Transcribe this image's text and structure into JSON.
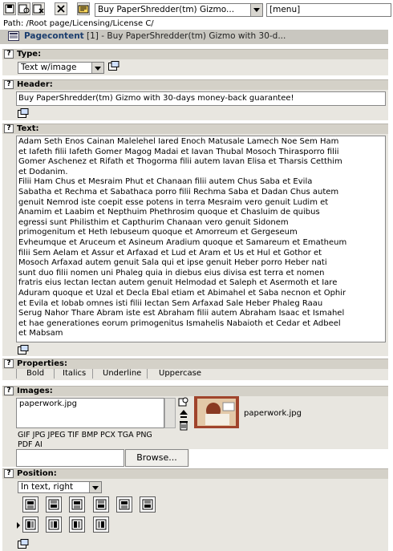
{
  "toolbar": {
    "buttons": [
      "save-icon",
      "save-view-icon",
      "save-close-icon",
      "close-icon",
      "edit-icon"
    ],
    "record_select": "Buy PaperShredder(tm) Gizmo...",
    "menu_select": "[menu]"
  },
  "path": "Path: /Root page/Licensing/License C/",
  "pagecontent": {
    "label": "Pagecontent",
    "title": "[1] - Buy PaperShredder(tm) Gizmo with 30-d..."
  },
  "type": {
    "label": "Type:",
    "value": "Text w/image"
  },
  "header": {
    "label": "Header:",
    "value": "Buy PaperShredder(tm) Gizmo with 30-days money-back guarantee!"
  },
  "text": {
    "label": "Text:",
    "lines": [
      "Adam Seth Enos Cainan Malelehel Iared Enoch Matusale Lamech Noe Sem Ham",
      "et Iafeth filii Iafeth Gomer Magog Madai et Iavan Thubal Mosoch Thirasporro filii",
      "Gomer Aschenez et Rifath et Thogorma filii autem Iavan Elisa et Tharsis Cetthim",
      "et Dodanim.",
      "Filii Ham Chus et Mesraim Phut et Chanaan filii autem Chus Saba et Evila",
      "Sabatha et Rechma et Sabathaca porro filii Rechma Saba et Dadan Chus autem",
      "genuit Nemrod iste coepit esse potens in terra Mesraim vero genuit Ludim et",
      "Anamim et Laabim et Nepthuim Phethrosim quoque et Chasluim de quibus",
      "egressi sunt Philisthim et Capthurim Chanaan vero genuit Sidonem",
      "primogenitum et Heth Iebuseum quoque et Amorreum et Gergeseum",
      "Evheumque et Aruceum et Asineum Aradium quoque et Samareum et Ematheum",
      "filii Sem Aelam et Assur et Arfaxad et Lud et Aram et Us et Hul et Gothor et",
      "Mosoch Arfaxad autem genuit Sala qui et ipse genuit Heber porro Heber nati",
      "sunt duo filii nomen uni Phaleg quia in diebus eius divisa est terra et nomen",
      "fratris eius Iectan Iectan autem genuit Helmodad et Saleph et Asermoth et Iare",
      "Aduram quoque et Uzal et Decla Ebal etiam et Abimahel et Saba necnon et Ophir",
      "et Evila et Iobab omnes isti filii Iectan Sem Arfaxad Sale Heber Phaleg Raau",
      "Serug Nahor Thare Abram iste est Abraham filii autem Abraham Isaac et Ismahel",
      "et hae generationes eorum primogenitus Ismahelis Nabaioth et Cedar et Adbeel",
      "et Mabsam"
    ]
  },
  "properties": {
    "label": "Properties:",
    "options": [
      "Bold",
      "Italics",
      "Underline",
      "Uppercase"
    ]
  },
  "images": {
    "label": "Images:",
    "selected_file": "paperwork.jpg",
    "thumbnail_caption": "paperwork.jpg",
    "allowed_types_line1": "GIF JPG JPEG TIF BMP PCX TGA PNG",
    "allowed_types_line2": "PDF AI",
    "browse_label": "Browse..."
  },
  "position": {
    "label": "Position:",
    "value": "In text, right"
  },
  "colors": {
    "section_header": "#d4d1c8",
    "section_body": "#e8e6e0",
    "pagecontent_bar": "#c9c7c0"
  }
}
